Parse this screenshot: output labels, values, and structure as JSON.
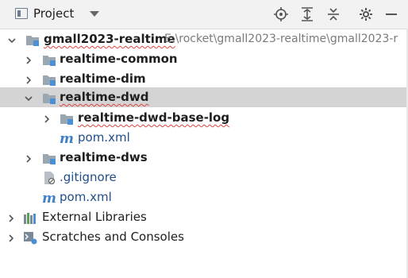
{
  "toolbar": {
    "title": "Project",
    "icons": [
      "locate-icon",
      "expand-all-icon",
      "collapse-all-icon",
      "settings-icon",
      "hide-icon"
    ]
  },
  "tree": {
    "root": {
      "label": "gmall2023-realtime",
      "path": "E:\\rocket\\gmall2023-realtime\\gmall2023-r"
    },
    "items": [
      {
        "label": "realtime-common"
      },
      {
        "label": "realtime-dim"
      },
      {
        "label": "realtime-dwd"
      },
      {
        "label": "realtime-dwd-base-log"
      },
      {
        "label": "pom.xml"
      },
      {
        "label": "realtime-dws"
      },
      {
        "label": ".gitignore"
      },
      {
        "label": "pom.xml"
      },
      {
        "label": "External Libraries"
      },
      {
        "label": "Scratches and Consoles"
      }
    ]
  },
  "colors": {
    "selected_row": "#d4d4d4",
    "module_blue": "#4b8fd6",
    "error_squiggle": "#e0443e"
  }
}
